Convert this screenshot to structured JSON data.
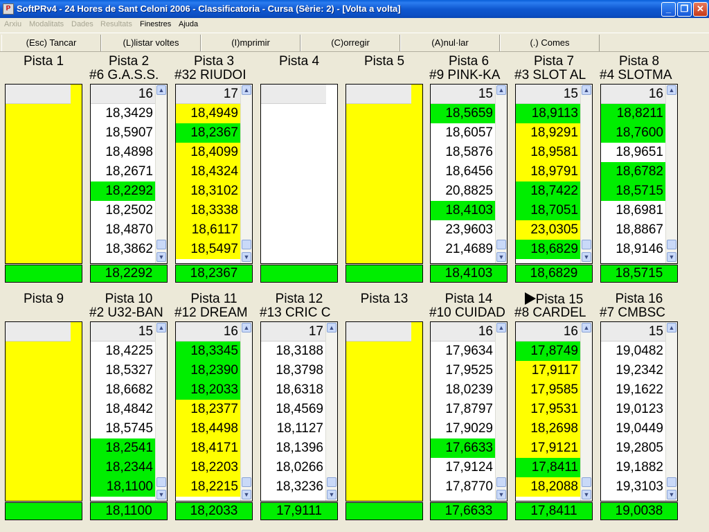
{
  "window": {
    "title": "SoftPRv4 - 24 Hores de Sant Celoni 2006 - Classificatoria - Cursa (Sèrie: 2) - [Volta a volta]",
    "icon": "P",
    "btn_min": "_",
    "btn_max": "❐",
    "btn_close": "✕"
  },
  "menu": [
    {
      "label": "Arxiu",
      "enabled": false
    },
    {
      "label": "Modalitats",
      "enabled": false
    },
    {
      "label": "Dades",
      "enabled": false
    },
    {
      "label": "Resultats",
      "enabled": false
    },
    {
      "label": "Finestres",
      "enabled": true
    },
    {
      "label": "Ajuda",
      "enabled": true
    }
  ],
  "toolbar": [
    {
      "label": "(Esc) Tancar"
    },
    {
      "label": "(L)listar voltes"
    },
    {
      "label": "(I)mprimir"
    },
    {
      "label": "(C)orregir"
    },
    {
      "label": "(A)nul·lar"
    },
    {
      "label": "(.) Comes"
    }
  ],
  "colors": {
    "green": "#00ee00",
    "yellow": "#ffff00",
    "white": "#ffffff"
  },
  "current_track_marker": "arrow-right",
  "tracks": [
    {
      "name": "Pista 1",
      "team": "",
      "empty": true,
      "best": "",
      "laps": []
    },
    {
      "name": "Pista 2",
      "team": "#6 G.A.S.S.",
      "empty": false,
      "lap_count": "16",
      "best": "18,2292",
      "laps": [
        [
          "18,3429",
          "white"
        ],
        [
          "18,5907",
          "white"
        ],
        [
          "18,4898",
          "white"
        ],
        [
          "18,2671",
          "white"
        ],
        [
          "18,2292",
          "green"
        ],
        [
          "18,2502",
          "white"
        ],
        [
          "18,4870",
          "white"
        ],
        [
          "18,3862",
          "white"
        ]
      ]
    },
    {
      "name": "Pista 3",
      "team": "#32 RIUDOI",
      "empty": false,
      "lap_count": "17",
      "best": "18,2367",
      "laps": [
        [
          "18,4949",
          "yellow"
        ],
        [
          "18,2367",
          "green"
        ],
        [
          "18,4099",
          "yellow"
        ],
        [
          "18,4324",
          "yellow"
        ],
        [
          "18,3102",
          "yellow"
        ],
        [
          "18,3338",
          "yellow"
        ],
        [
          "18,6117",
          "yellow"
        ],
        [
          "18,5497",
          "yellow"
        ]
      ]
    },
    {
      "name": "Pista 4",
      "team": "",
      "empty": false,
      "white_empty": true,
      "lap_count": "",
      "best": "",
      "laps": []
    },
    {
      "name": "Pista 5",
      "team": "",
      "empty": true,
      "best": "",
      "laps": []
    },
    {
      "name": "Pista 6",
      "team": "#9 PINK-KA",
      "empty": false,
      "lap_count": "15",
      "best": "18,4103",
      "laps": [
        [
          "18,5659",
          "green"
        ],
        [
          "18,6057",
          "white"
        ],
        [
          "18,5876",
          "white"
        ],
        [
          "18,6456",
          "white"
        ],
        [
          "20,8825",
          "white"
        ],
        [
          "18,4103",
          "green"
        ],
        [
          "23,9603",
          "white"
        ],
        [
          "21,4689",
          "white"
        ]
      ]
    },
    {
      "name": "Pista 7",
      "team": "#3 SLOT AL",
      "empty": false,
      "lap_count": "15",
      "best": "18,6829",
      "laps": [
        [
          "18,9113",
          "green"
        ],
        [
          "18,9291",
          "yellow"
        ],
        [
          "18,9581",
          "yellow"
        ],
        [
          "18,9791",
          "yellow"
        ],
        [
          "18,7422",
          "green"
        ],
        [
          "18,7051",
          "green"
        ],
        [
          "23,0305",
          "yellow"
        ],
        [
          "18,6829",
          "green"
        ]
      ]
    },
    {
      "name": "Pista 8",
      "team": "#4 SLOTMA",
      "empty": false,
      "lap_count": "16",
      "best": "18,5715",
      "laps": [
        [
          "18,8211",
          "green"
        ],
        [
          "18,7600",
          "green"
        ],
        [
          "18,9651",
          "white"
        ],
        [
          "18,6782",
          "green"
        ],
        [
          "18,5715",
          "green"
        ],
        [
          "18,6981",
          "white"
        ],
        [
          "18,8867",
          "white"
        ],
        [
          "18,9146",
          "white"
        ]
      ]
    },
    {
      "name": "Pista 9",
      "team": "",
      "empty": true,
      "best": "",
      "laps": []
    },
    {
      "name": "Pista 10",
      "team": "#2 U32-BAN",
      "empty": false,
      "lap_count": "15",
      "best": "18,1100",
      "laps": [
        [
          "18,4225",
          "white"
        ],
        [
          "18,5327",
          "white"
        ],
        [
          "18,6682",
          "white"
        ],
        [
          "18,4842",
          "white"
        ],
        [
          "18,5745",
          "white"
        ],
        [
          "18,2541",
          "green"
        ],
        [
          "18,2344",
          "green"
        ],
        [
          "18,1100",
          "green"
        ]
      ]
    },
    {
      "name": "Pista 11",
      "team": "#12 DREAM",
      "empty": false,
      "lap_count": "16",
      "best": "18,2033",
      "laps": [
        [
          "18,3345",
          "green"
        ],
        [
          "18,2390",
          "green"
        ],
        [
          "18,2033",
          "green"
        ],
        [
          "18,2377",
          "yellow"
        ],
        [
          "18,4498",
          "yellow"
        ],
        [
          "18,4171",
          "yellow"
        ],
        [
          "18,2203",
          "yellow"
        ],
        [
          "18,2215",
          "yellow"
        ]
      ]
    },
    {
      "name": "Pista 12",
      "team": "#13 CRIC C",
      "empty": false,
      "lap_count": "17",
      "best": "17,9111",
      "laps": [
        [
          "18,3188",
          "white"
        ],
        [
          "18,3798",
          "white"
        ],
        [
          "18,6318",
          "white"
        ],
        [
          "18,4569",
          "white"
        ],
        [
          "18,1127",
          "white"
        ],
        [
          "18,1396",
          "white"
        ],
        [
          "18,0266",
          "white"
        ],
        [
          "18,3236",
          "white"
        ]
      ]
    },
    {
      "name": "Pista 13",
      "team": "",
      "empty": true,
      "best": "",
      "laps": []
    },
    {
      "name": "Pista 14",
      "team": "#10 CUIDAD",
      "empty": false,
      "lap_count": "16",
      "best": "17,6633",
      "laps": [
        [
          "17,9634",
          "white"
        ],
        [
          "17,9525",
          "white"
        ],
        [
          "18,0239",
          "white"
        ],
        [
          "17,8797",
          "white"
        ],
        [
          "17,9029",
          "white"
        ],
        [
          "17,6633",
          "green"
        ],
        [
          "17,9124",
          "white"
        ],
        [
          "17,8770",
          "white"
        ]
      ]
    },
    {
      "name": "Pista 15",
      "team": "#8 CARDEL",
      "empty": false,
      "marker": true,
      "lap_count": "16",
      "best": "17,8411",
      "laps": [
        [
          "17,8749",
          "green"
        ],
        [
          "17,9117",
          "yellow"
        ],
        [
          "17,9585",
          "yellow"
        ],
        [
          "17,9531",
          "yellow"
        ],
        [
          "18,2698",
          "yellow"
        ],
        [
          "17,9121",
          "yellow"
        ],
        [
          "17,8411",
          "green"
        ],
        [
          "18,2088",
          "yellow"
        ]
      ]
    },
    {
      "name": "Pista 16",
      "team": "#7 CMBSC",
      "empty": false,
      "lap_count": "15",
      "best": "19,0038",
      "laps": [
        [
          "19,0482",
          "white"
        ],
        [
          "19,2342",
          "white"
        ],
        [
          "19,1622",
          "white"
        ],
        [
          "19,0123",
          "white"
        ],
        [
          "19,0449",
          "white"
        ],
        [
          "19,2805",
          "white"
        ],
        [
          "19,1882",
          "white"
        ],
        [
          "19,3103",
          "white"
        ]
      ]
    }
  ]
}
